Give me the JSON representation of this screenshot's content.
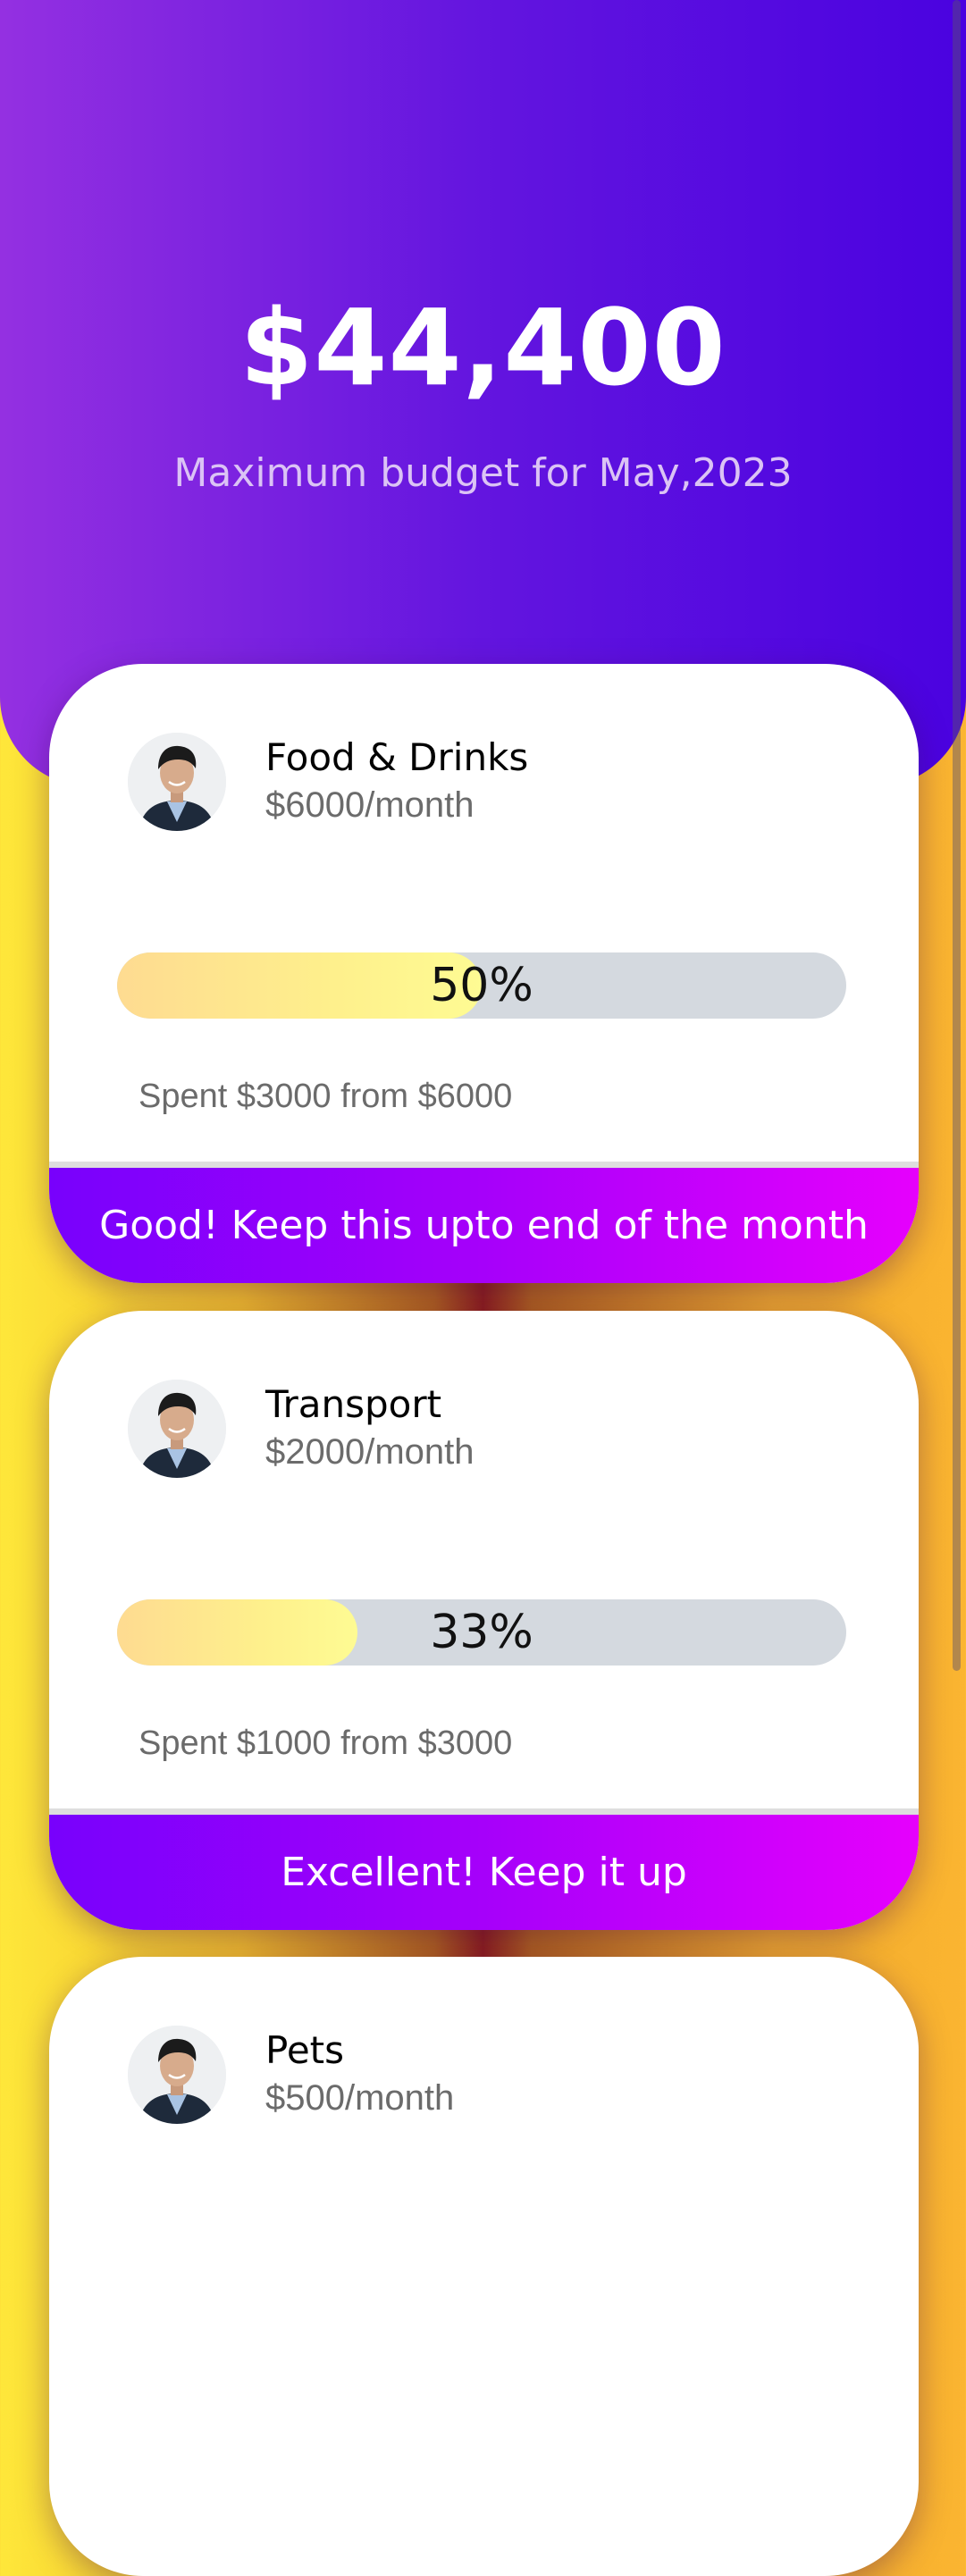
{
  "header": {
    "amount": "$44,400",
    "subtitle": "Maximum budget for May,2023"
  },
  "colors": {
    "header_gradient": [
      "#9430e1",
      "#4a02e0"
    ],
    "banner_gradient": [
      "#7801fc",
      "#e600fd"
    ],
    "progress_fill": [
      "#fedb91",
      "#fefb93"
    ],
    "progress_track": "#d4d9df"
  },
  "categories": [
    {
      "avatar": "person-photo",
      "title": "Food & Drinks",
      "budget": "$6000/month",
      "progress_percent": 50,
      "progress_label": "50%",
      "spent": "Spent $3000 from $6000",
      "message": "Good! Keep this upto end of the month"
    },
    {
      "avatar": "person-photo",
      "title": "Transport",
      "budget": "$2000/month",
      "progress_percent": 33,
      "progress_label": "33%",
      "spent": "Spent $1000 from $3000",
      "message": "Excellent! Keep it up"
    },
    {
      "avatar": "person-photo",
      "title": "Pets",
      "budget": "$500/month"
    }
  ]
}
